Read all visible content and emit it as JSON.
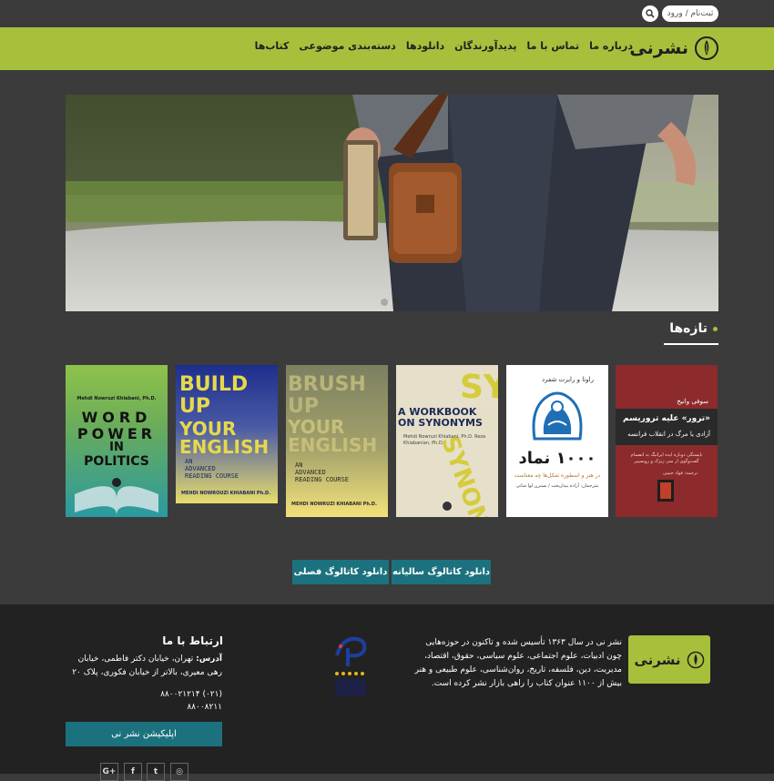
{
  "topbar": {
    "login_label": "ثبت‌نام / ورود",
    "search_icon": "search-icon"
  },
  "nav": {
    "logo_text": "نشرنی",
    "items": [
      {
        "label": "کتاب‌ها"
      },
      {
        "label": "دسته‌بندی موضوعی"
      },
      {
        "label": "دانلودها"
      },
      {
        "label": "پدیدآورندگان"
      },
      {
        "label": "تماس با ما"
      },
      {
        "label": "درباره ما"
      }
    ]
  },
  "slider": {
    "slide_count": 2,
    "active_slide": 2
  },
  "new_releases": {
    "title": "تازه‌ها",
    "books": [
      {
        "title_line1": "«ترور» علیه تروریسم",
        "subtitle": "آزادی یا مرگ در انقلاب فرانسه",
        "author": "سوفی وانیخ",
        "desc": "بایستگی دوباره ایده ایرانیگ به انضمام گفت‌وگوی از سی ژیژک و روبسپیر",
        "translator": "ترجمه: فواد حبیبی"
      },
      {
        "authors": "راونا و رابرت شفرد",
        "title": "۱۰۰۰ نماد",
        "subtitle": "در هنر و اسطوره شکل‌ها چه معناست",
        "translators": "مترجمان: آزاده بیداربخت / نسترن لوا شانی"
      },
      {
        "title_top": "SY",
        "title": "A WORKBOOK ON SYNONYMS",
        "authors_line": "Mehdi Nowruzi Khiabani, Ph.D. Reza Khiabanian, Ph.D."
      },
      {
        "title_top": "BRUSH UP",
        "title": "YOUR ENGLISH",
        "desc1": "AN",
        "desc2": "ADVANCED",
        "desc3": "READING COURSE",
        "author": "MEHDI NOWRUZI KHIABANI Ph.D."
      },
      {
        "title_top": "BUILD UP",
        "title": "YOUR ENGLISH",
        "desc1": "AN",
        "desc2": "ADVANCED",
        "desc3": "READING COURSE",
        "author": "MEHDI NOWROUZI KHIABANI Ph.D."
      },
      {
        "author": "Mehdi Nowruzi Khiabani, Ph.D.",
        "line1": "WORD",
        "line2": "POWER",
        "line3": "IN",
        "line4": "POLITICS"
      }
    ]
  },
  "catalog": {
    "annual_label": "دانلود کاتالوگ سالیانه",
    "seasonal_label": "دانلود کاتالوگ فصلی"
  },
  "footer": {
    "logo_text": "نشرنی",
    "about": "نشر نی در سال ۱۳۶۳ تأسیس شده و تاکنون در حوزه‌هایی چون ادبیات، علوم اجتماعی، علوم سیاسی، حقوق، اقتصاد، مدیریت، دین، فلسفه، تاریخ، روان‌شناسی، علوم طبیعی و هنر بیش از ۱۱۰۰ عنوان کتاب را راهی بازار نشر کرده است.",
    "contact_title": "ارتباط با ما",
    "address_label": "آدرس:",
    "address": "تهران، خیابان دکتر فاطمی، خیابان رهی معیری، بالاتر از خیابان فکوری، پلاک ۲۰",
    "phone1": "(۰۲۱) ۸۸۰۰۲۱۲۱۴",
    "phone2": "۸۸۰۰۸۲۱۱",
    "app_label": "اپلیکیشن نشر نی",
    "social": [
      {
        "icon": "instagram-icon",
        "glyph": "◎"
      },
      {
        "icon": "twitter-icon",
        "glyph": "t"
      },
      {
        "icon": "facebook-icon",
        "glyph": "f"
      },
      {
        "icon": "google-plus-icon",
        "glyph": "G+"
      }
    ]
  }
}
